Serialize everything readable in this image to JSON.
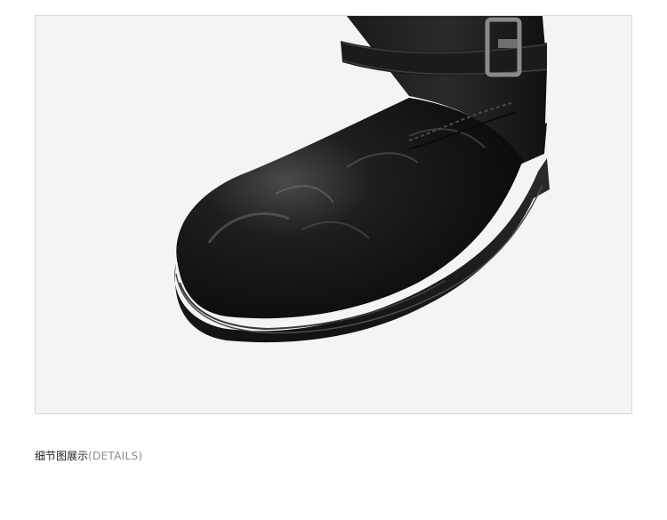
{
  "product_image": {
    "subject": "black-leather-boot-toe-detail",
    "background_color": "#f4f4f4",
    "frame_color": "#d9d9d9"
  },
  "caption": {
    "main": "细节图展示",
    "sub": "(DETAILS)"
  }
}
